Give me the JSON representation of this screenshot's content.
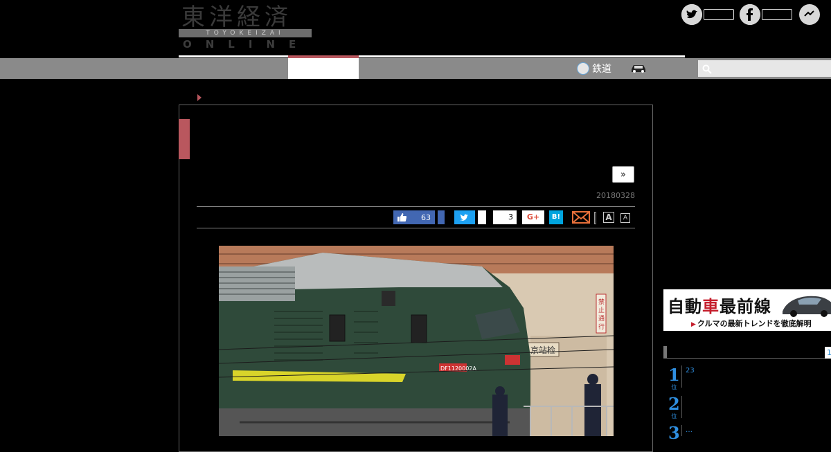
{
  "header": {
    "logo_kanji": "東洋経済",
    "logo_romaji": "TOYOKEIZAI",
    "logo_online": "ONLINE",
    "social": [
      {
        "icon": "twitter-icon",
        "glyph": "t"
      },
      {
        "icon": "facebook-icon",
        "glyph": "f"
      },
      {
        "icon": "messenger-icon",
        "glyph": "~"
      }
    ]
  },
  "nav": {
    "rail_label": "鉄道",
    "search_placeholder": ""
  },
  "article": {
    "next_label": "»",
    "date": "20180328",
    "like_count": "63",
    "share_count": "3",
    "gplus_label": "G+",
    "hatena_label": "B!",
    "font_large_label": "A",
    "font_small_label": "A",
    "photo_sign": "京站检",
    "photo_vertical_sign": "禁止通行",
    "loco_number": "DF1120002A"
  },
  "sidebar": {
    "banner_title_prefix": "自動",
    "banner_title_red": "車",
    "banner_title_suffix": "最前線",
    "banner_sub": "クルマの最新トレンドを徹底解明",
    "ranking_tab": "1",
    "ranking": [
      {
        "rank": "1",
        "suffix": "位",
        "text": "23"
      },
      {
        "rank": "2",
        "suffix": "位",
        "text": ""
      },
      {
        "rank": "3",
        "suffix": "",
        "text": "…"
      }
    ]
  },
  "colors": {
    "accent": "#b9575e",
    "navbar": "#8a8a8a",
    "facebook": "#4267b2",
    "twitter": "#1da1f2",
    "hatena": "#00a4de",
    "rank_blue": "#2f8fe0"
  }
}
